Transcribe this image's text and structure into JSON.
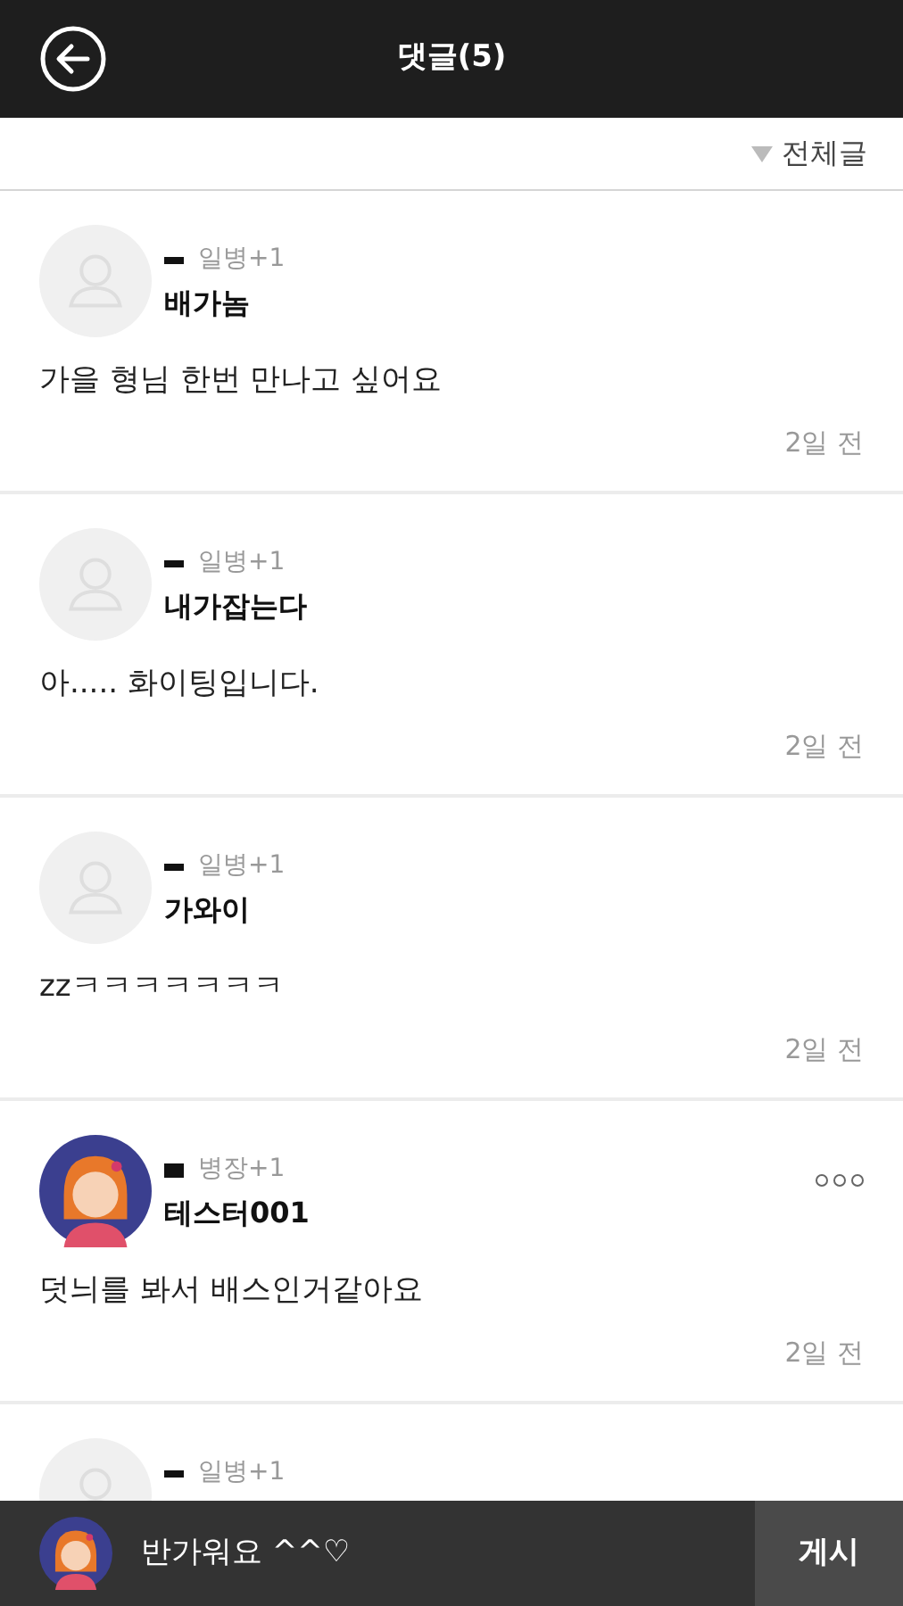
{
  "header": {
    "title": "댓글(5)"
  },
  "filter": {
    "label": "전체글"
  },
  "comments": [
    {
      "kind": "placeholder",
      "rank": "일병+1",
      "name": "배가놈",
      "body": "가을 형님 한번 만나고 싶어요",
      "time": "2일 전",
      "more_menu": false
    },
    {
      "kind": "placeholder",
      "rank": "일병+1",
      "name": "내가잡는다",
      "body": "아..... 화이팅입니다.",
      "time": "2일 전",
      "more_menu": false
    },
    {
      "kind": "placeholder",
      "rank": "일병+1",
      "name": "가와이",
      "body": "zzㅋㅋㅋㅋㅋㅋㅋ",
      "time": "2일 전",
      "more_menu": false
    },
    {
      "kind": "custom",
      "rank": "병장+1",
      "name": "테스터001",
      "body": "덧늬를 봐서 배스인거같아요",
      "time": "2일 전",
      "more_menu": true
    },
    {
      "kind": "placeholder",
      "rank": "일병+1",
      "more_menu": false
    }
  ],
  "composer": {
    "value": "반가워요 ^^♡",
    "submit": "게시"
  }
}
